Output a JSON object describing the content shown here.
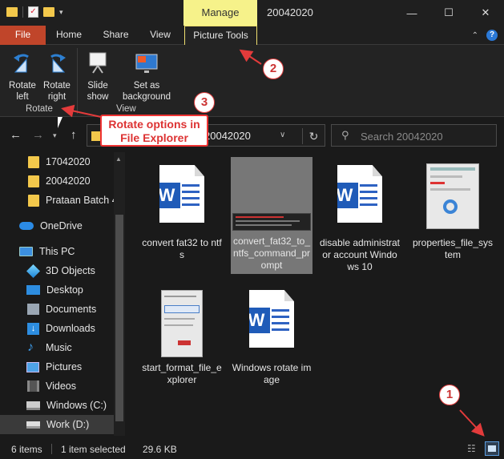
{
  "titlebar": {
    "manage_label": "Manage",
    "window_title": "20042020",
    "minimize_icon": "—",
    "maximize_icon": "☐",
    "close_icon": "✕"
  },
  "ribbon_tabs": {
    "file": "File",
    "home": "Home",
    "share": "Share",
    "view": "View",
    "picture_tools": "Picture Tools",
    "collapse_icon": "⌃",
    "help_icon": "?"
  },
  "ribbon": {
    "rotate_left": "Rotate left",
    "rotate_right": "Rotate right",
    "slide_show": "Slide show",
    "set_as_background": "Set as background",
    "group_rotate": "Rotate",
    "group_view": "View"
  },
  "address_bar": {
    "path_more": "«",
    "path": "20042020",
    "search_placeholder": "Search 20042020"
  },
  "nav_pane": {
    "items": [
      {
        "label": "17042020",
        "icon": "folder-icon"
      },
      {
        "label": "20042020",
        "icon": "folder-icon"
      },
      {
        "label": "Prataan Batch 4",
        "icon": "folder-icon"
      },
      {
        "label": "OneDrive",
        "icon": "onedrive-icon"
      },
      {
        "label": "This PC",
        "icon": "pc-icon"
      },
      {
        "label": "3D Objects",
        "icon": "3d-objects-icon"
      },
      {
        "label": "Desktop",
        "icon": "desktop-icon"
      },
      {
        "label": "Documents",
        "icon": "documents-icon"
      },
      {
        "label": "Downloads",
        "icon": "downloads-icon"
      },
      {
        "label": "Music",
        "icon": "music-icon"
      },
      {
        "label": "Pictures",
        "icon": "pictures-icon"
      },
      {
        "label": "Videos",
        "icon": "videos-icon"
      },
      {
        "label": "Windows (C:)",
        "icon": "drive-icon"
      },
      {
        "label": "Work (D:)",
        "icon": "drive-icon"
      }
    ]
  },
  "files": [
    {
      "name": "convert fat32 to ntfs",
      "type": "word-document-icon"
    },
    {
      "name": "convert_fat32_to_ntfs_command_prompt",
      "type": "image-thumbnail",
      "selected": true
    },
    {
      "name": "disable administrator account Windows 10",
      "type": "word-document-icon"
    },
    {
      "name": "properties_file_system",
      "type": "image-thumbnail"
    },
    {
      "name": "start_format_file_explorer",
      "type": "image-thumbnail"
    },
    {
      "name": "Windows rotate image",
      "type": "word-document-icon"
    }
  ],
  "status_bar": {
    "item_count": "6 items",
    "selection": "1 item selected",
    "size": "29.6 KB"
  },
  "annotations": {
    "badge_1": "1",
    "badge_2": "2",
    "badge_3": "3",
    "callout_line1": "Rotate options in",
    "callout_line2": "File Explorer",
    "arrow_color": "#e33b3b"
  },
  "colors": {
    "file_tab": "#c0452a",
    "manage_tab": "#f6f28a",
    "word_blue": "#1f5bb8",
    "folder_yellow": "#f3c84b"
  }
}
